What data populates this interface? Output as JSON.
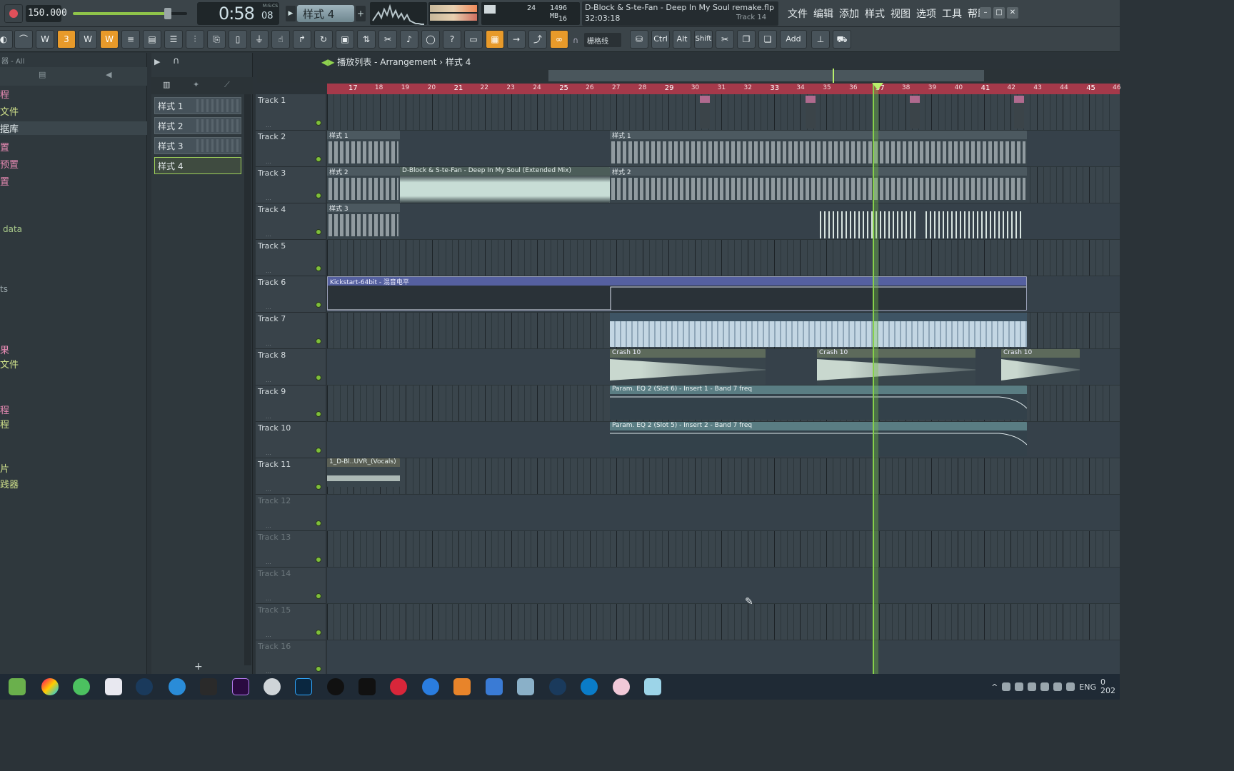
{
  "topbar": {
    "tempo": "150.000",
    "time": "0:58",
    "time_sub": "08",
    "time_unit": "M:S:CS",
    "pattern": "样式 4",
    "pattern_add": "+",
    "cpu_voices": "24",
    "mem": "1496 MB",
    "poly": "16",
    "hint_title": "D-Block & S-te-Fan - Deep In My Soul remake.flp",
    "hint_time": "32:03:18",
    "hint_track": "Track 14",
    "menu": [
      "文件",
      "编辑",
      "添加",
      "样式",
      "视图",
      "选项",
      "工具",
      "帮助"
    ],
    "win": [
      "–",
      "□",
      "✕"
    ]
  },
  "toolbar": {
    "snap": "栅格线",
    "keys": [
      "Ctrl",
      "Alt",
      "Shift",
      "Add"
    ]
  },
  "browser": {
    "header": "器 - All",
    "items": [
      {
        "label": "程",
        "color": "#e68ab3"
      },
      {
        "label": "文件",
        "color": "#cfe08a"
      },
      {
        "label": "据库",
        "color": "#e6eef0"
      },
      {
        "label": "置",
        "color": "#e68ab3"
      },
      {
        "label": "预置",
        "color": "#e68ab3"
      },
      {
        "label": "置",
        "color": "#e68ab3"
      },
      {
        "label": "data",
        "color": "#a8c98a"
      },
      {
        "label": "ts",
        "color": "#9aa6ab"
      },
      {
        "label": "果",
        "color": "#e68ab3"
      },
      {
        "label": "文件",
        "color": "#cfe08a"
      },
      {
        "label": "程",
        "color": "#e68ab3"
      },
      {
        "label": "程",
        "color": "#cfe08a"
      },
      {
        "label": "片",
        "color": "#cfe08a"
      },
      {
        "label": "践器",
        "color": "#cfe08a"
      }
    ]
  },
  "picker": {
    "patterns": [
      "样式 1",
      "样式 2",
      "样式 3",
      "样式 4"
    ],
    "add": "+"
  },
  "playlist": {
    "breadcrumb": "播放列表 - Arrangement › 样式 4",
    "ruler": [
      "17",
      "18",
      "19",
      "20",
      "21",
      "22",
      "23",
      "24",
      "25",
      "26",
      "27",
      "28",
      "29",
      "30",
      "31",
      "32",
      "33",
      "34",
      "35",
      "36",
      "37",
      "38",
      "39",
      "40",
      "41",
      "42",
      "43",
      "44",
      "45",
      "46"
    ],
    "tracks": [
      "Track 1",
      "Track 2",
      "Track 3",
      "Track 4",
      "Track 5",
      "Track 6",
      "Track 7",
      "Track 8",
      "Track 9",
      "Track 10",
      "Track 11",
      "Track 12",
      "Track 13",
      "Track 14",
      "Track 15",
      "Track 16"
    ],
    "clips": {
      "pat1a": "样式 1",
      "pat1b": "样式 1",
      "pat2a": "样式 2",
      "audio_main": "D-Block & S-te-Fan - Deep In My Soul (Extended Mix)",
      "pat2b": "样式 2",
      "pat3": "样式 3",
      "kickstart": "Kickstart-64bit - 混音电平",
      "crash1": "Crash 10",
      "crash2": "Crash 10",
      "crash3": "Crash 10",
      "eq1": "Param. EQ 2 (Slot 6) - Insert 1 - Band 7 freq",
      "eq2": "Param. EQ 2 (Slot 5) - Insert 2 - Band 7 freq",
      "vocals": "1_D-Bl..UVR_(Vocals)"
    }
  },
  "taskbar": {
    "lang": "ENG",
    "clock": "0",
    "year": "202"
  },
  "colors": {
    "accent_orange": "#e89a2a",
    "ruler_red": "#a5394a",
    "playhead_green": "#86d14a"
  }
}
